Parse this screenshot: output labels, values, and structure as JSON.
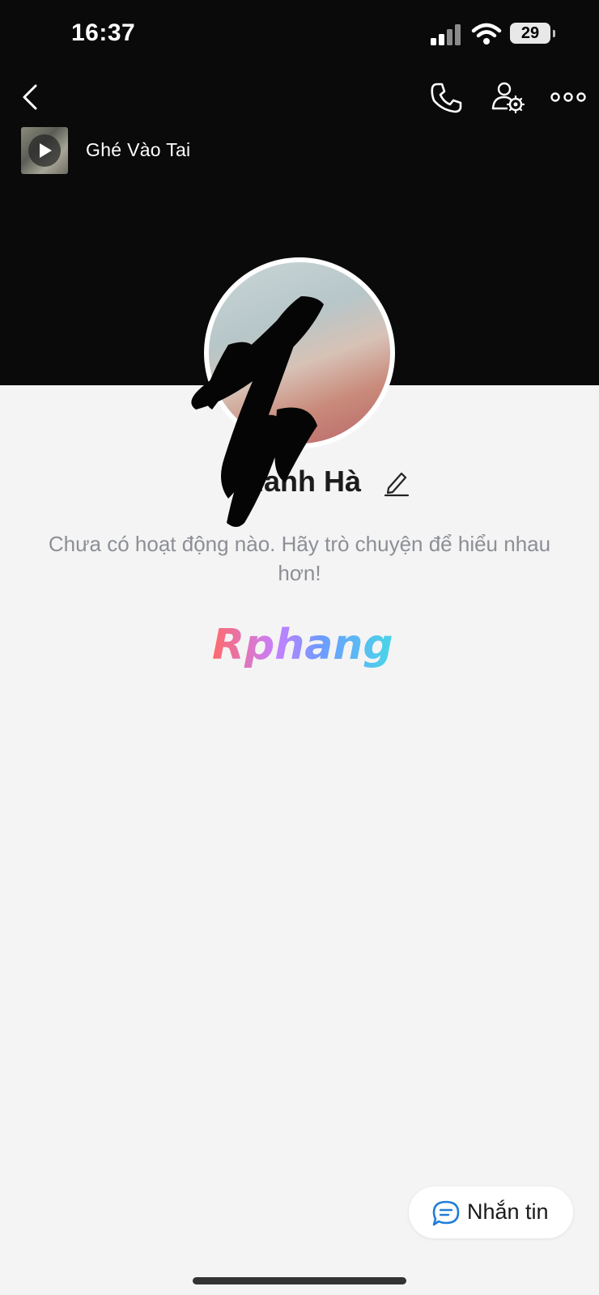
{
  "status_bar": {
    "time": "16:37",
    "battery": "29"
  },
  "nav": {
    "back_icon": "chevron-left-icon",
    "call_icon": "phone-icon",
    "settings_icon": "user-settings-icon",
    "more_icon": "more-dots-icon"
  },
  "music": {
    "title": "Ghé Vào Tai",
    "icon": "play-icon"
  },
  "profile": {
    "name": "Thanh Hà",
    "empty_activity": "Chưa có hoạt động nào. Hãy trò chuyện để hiểu nhau hơn!"
  },
  "watermark": "Rphang",
  "actions": {
    "message_label": "Nhắn tin",
    "message_icon": "chat-bubble-icon"
  },
  "colors": {
    "header_bg": "#0a0a0a",
    "page_bg": "#f4f4f4",
    "accent_blue": "#1f7ed8",
    "muted_text": "#8d8f96"
  }
}
